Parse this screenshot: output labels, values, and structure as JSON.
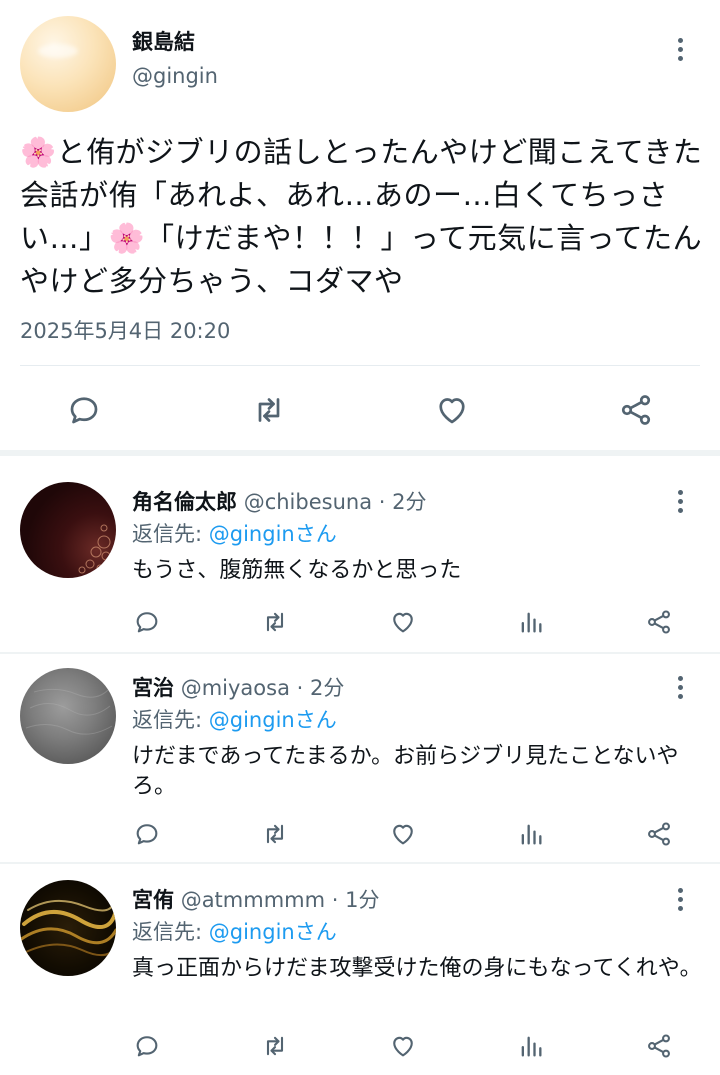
{
  "main_tweet": {
    "name": "銀島結",
    "handle": "@gingin",
    "text": "🌸と侑がジブリの話しとったんやけど聞こえてきた会話が侑「あれよ、あれ…あのー…白くてちっさい…」🌸「けだまや！！！」って元気に言ってたんやけど多分ちゃう、コダマや",
    "timestamp": "2025年5月4日 20:20",
    "actions": [
      "reply-icon",
      "retweet-icon",
      "like-icon",
      "share-icon"
    ]
  },
  "replies": [
    {
      "name": "角名倫太郎",
      "handle": "@chibesuna",
      "time": "· 2分",
      "reply_label": "返信先: ",
      "reply_to": "@ginginさん",
      "text": "もうさ、腹筋無くなるかと思った"
    },
    {
      "name": "宮治",
      "handle": "@miyaosa",
      "time": "· 2分",
      "reply_label": "返信先: ",
      "reply_to": "@ginginさん",
      "text": "けだまであってたまるか。お前らジブリ見たことないやろ。"
    },
    {
      "name": "宮侑",
      "handle": "@atmmmmm",
      "time": "· 1分",
      "reply_label": "返信先: ",
      "reply_to": "@ginginさん",
      "text": "真っ正面からけだま攻撃受けた俺の身にもなってくれや。"
    }
  ],
  "colors": {
    "text": "#0f1419",
    "secondary": "#536471",
    "link": "#1d9bf0",
    "divider": "#eff3f4"
  }
}
